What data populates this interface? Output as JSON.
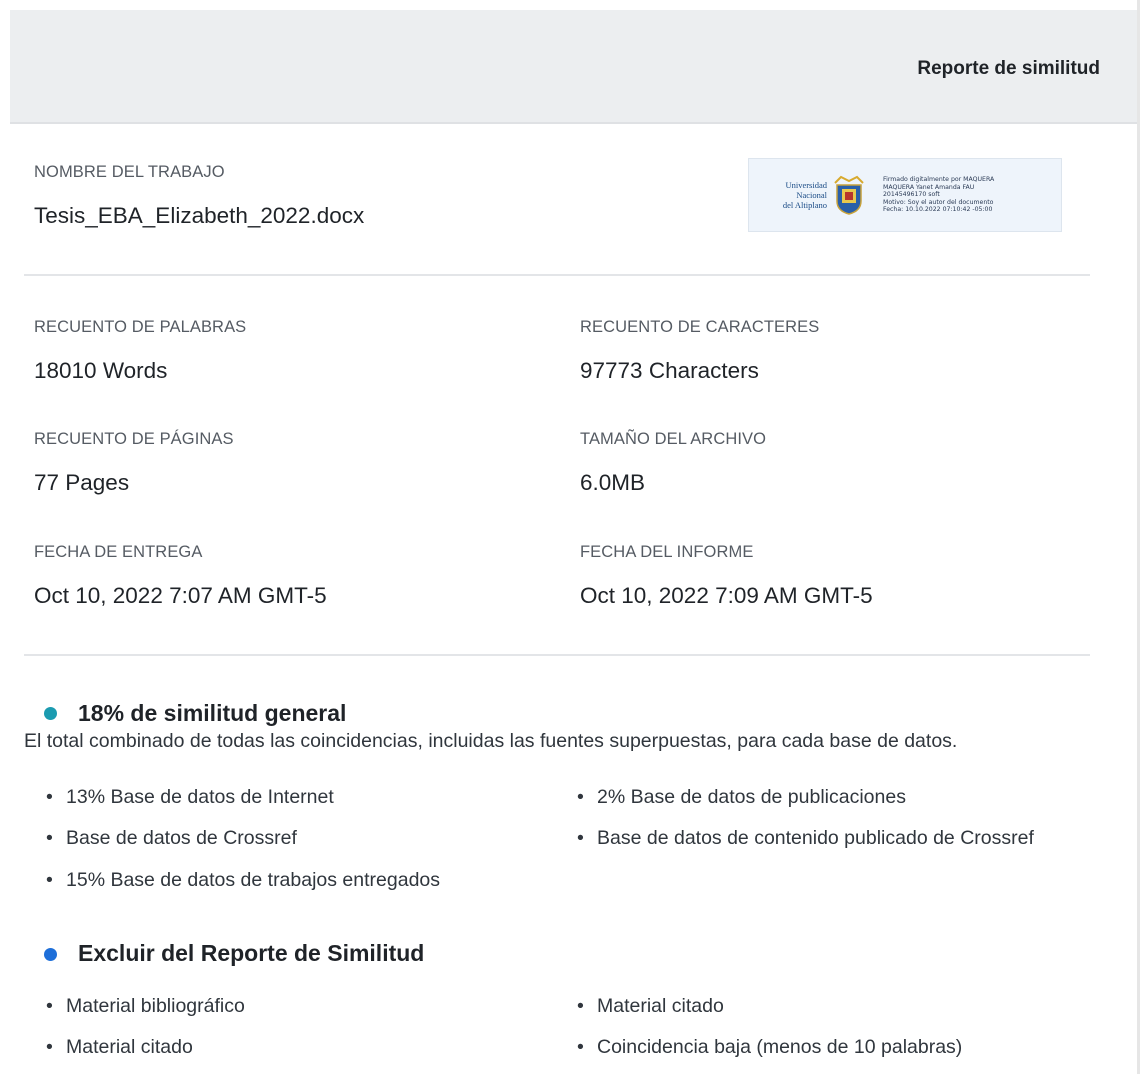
{
  "header": {
    "title": "Reporte de similitud"
  },
  "stamp": {
    "university_lines": [
      "Universidad",
      "Nacional",
      "del Altiplano"
    ],
    "signature_lines": [
      "Firmado digitalmente por MAQUERA",
      "MAQUERA Yanet Amanda FAU",
      "20145496170 soft",
      "Motivo: Soy el autor del documento",
      "Fecha: 10.10.2022 07:10:42 -05:00"
    ]
  },
  "job": {
    "label": "NOMBRE  DEL TRABAJO",
    "value": "Tesis_EBA_Elizabeth_2022.docx"
  },
  "stats": {
    "words_label": "RECUENTO DE PALABRAS",
    "words_value": "18010 Words",
    "chars_label": "RECUENTO  DE CARACTERES",
    "chars_value": "97773 Characters",
    "pages_label": "RECUENTO  DE PÁGINAS",
    "pages_value": "77 Pages",
    "size_label": "TAMAÑO DEL ARCHIVO",
    "size_value": "6.0MB",
    "submitted_label": "FECHA DE ENTREGA",
    "submitted_value": "Oct 10, 2022 7:07 AM GMT-5",
    "report_label": "FECHA DEL INFORME",
    "report_value": "Oct 10, 2022 7:09 AM GMT-5"
  },
  "similarity": {
    "title": "18% de similitud general",
    "dot_color": "#1b9bb0",
    "description": "El total combinado de todas las coincidencias, incluidas las fuentes superpuestas, para cada base de datos.",
    "items_left": [
      "13% Base de datos de Internet",
      "Base de datos de Crossref",
      "15% Base de datos de trabajos entregados"
    ],
    "items_right": [
      "2% Base de datos de publicaciones",
      "Base de datos de contenido publicado de Crossref"
    ]
  },
  "exclude": {
    "title": "Excluir  del Reporte de Similitud",
    "dot_color": "#1e6fd9",
    "items_left": [
      "Material bibliográfico",
      "Material citado"
    ],
    "items_right": [
      "Material citado",
      "Coincidencia baja (menos de 10 palabras)"
    ]
  }
}
